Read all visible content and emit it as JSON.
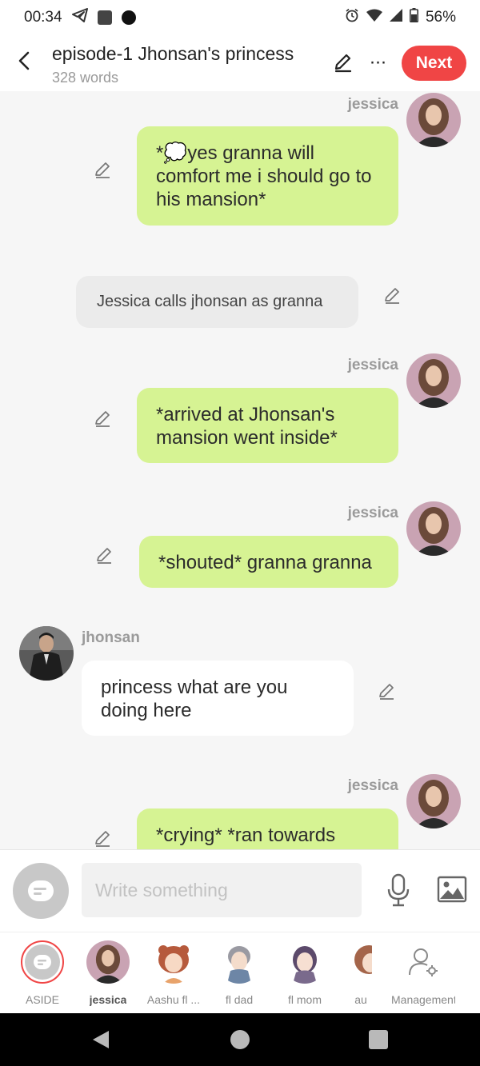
{
  "status": {
    "time": "00:34",
    "battery": "56%"
  },
  "header": {
    "title": "episode-1 Jhonsan's princess",
    "word_count": "328 words",
    "next_label": "Next"
  },
  "messages": [
    {
      "kind": "me",
      "speaker": "jessica",
      "text": "*💭yes granna will comfort me i should go to his mansion*"
    },
    {
      "kind": "aside",
      "text": "Jessica calls jhonsan as granna"
    },
    {
      "kind": "me",
      "speaker": "jessica",
      "text": "*arrived at Jhonsan's mansion went inside*"
    },
    {
      "kind": "me",
      "speaker": "jessica",
      "text": "*shouted* granna granna"
    },
    {
      "kind": "other",
      "speaker": "jhonsan",
      "text": "princess what are you doing here"
    },
    {
      "kind": "me",
      "speaker": "jessica",
      "text": "*crying* *ran towards"
    }
  ],
  "composer": {
    "placeholder": "Write something"
  },
  "characters": [
    {
      "label": "ASIDE"
    },
    {
      "label": "jessica"
    },
    {
      "label": "Aashu fl ..."
    },
    {
      "label": "fl dad"
    },
    {
      "label": "fl mom"
    },
    {
      "label": "au"
    },
    {
      "label": "Management"
    }
  ],
  "colors": {
    "accent": "#f04545",
    "my_bubble": "#d6f393",
    "other_bubble": "#ffffff",
    "aside_bubble": "#ebebeb"
  }
}
